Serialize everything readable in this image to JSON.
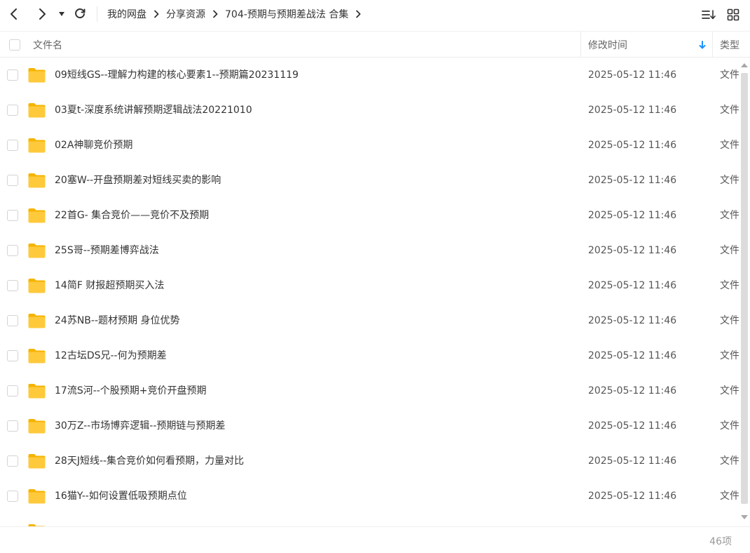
{
  "toolbar": {
    "back_icon": "chevron-left-icon",
    "forward_icon": "chevron-right-icon",
    "history_icon": "caret-down-icon",
    "refresh_icon": "refresh-icon",
    "sort_icon": "sort-list-icon",
    "grid_icon": "grid-view-icon"
  },
  "breadcrumb": [
    "我的网盘",
    "分享资源",
    "704-预期与预期差战法 合集"
  ],
  "header": {
    "name_col": "文件名",
    "time_col": "修改时间",
    "type_col": "类型",
    "sort_icon": "arrow-down-icon",
    "accent": "#1e90ff"
  },
  "files": [
    {
      "name": "09短线GS--理解力构建的核心要素1--预期篇20231119",
      "time": "2025-05-12 11:46",
      "type": "文件夹"
    },
    {
      "name": "03夏t-深度系统讲解预期逻辑战法20221010",
      "time": "2025-05-12 11:46",
      "type": "文件夹"
    },
    {
      "name": "02A神聊竞价预期",
      "time": "2025-05-12 11:46",
      "type": "文件夹"
    },
    {
      "name": "20塞W--开盘预期差对短线买卖的影响",
      "time": "2025-05-12 11:46",
      "type": "文件夹"
    },
    {
      "name": "22首G- 集合竞价——竞价不及预期",
      "time": "2025-05-12 11:46",
      "type": "文件夹"
    },
    {
      "name": "25S哥--预期差博弈战法",
      "time": "2025-05-12 11:46",
      "type": "文件夹"
    },
    {
      "name": "14简F 财报超预期买入法",
      "time": "2025-05-12 11:46",
      "type": "文件夹"
    },
    {
      "name": "24苏NB--题材预期  身位优势",
      "time": "2025-05-12 11:46",
      "type": "文件夹"
    },
    {
      "name": "12古坛DS兄--何为预期差",
      "time": "2025-05-12 11:46",
      "type": "文件夹"
    },
    {
      "name": "17流S河--个股预期+竞价开盘预期",
      "time": "2025-05-12 11:46",
      "type": "文件夹"
    },
    {
      "name": "30万Z--市场博弈逻辑--预期链与预期差",
      "time": "2025-05-12 11:46",
      "type": "文件夹"
    },
    {
      "name": "28天J短线--集合竞价如何看预期，力量对比",
      "time": "2025-05-12 11:46",
      "type": "文件夹"
    },
    {
      "name": "16猫Y--如何设置低吸预期点位",
      "time": "2025-05-12 11:46",
      "type": "文件夹"
    }
  ],
  "folder_icon": "folder-icon",
  "folder_color": "#ffc93c",
  "footer": {
    "count": "46项"
  }
}
